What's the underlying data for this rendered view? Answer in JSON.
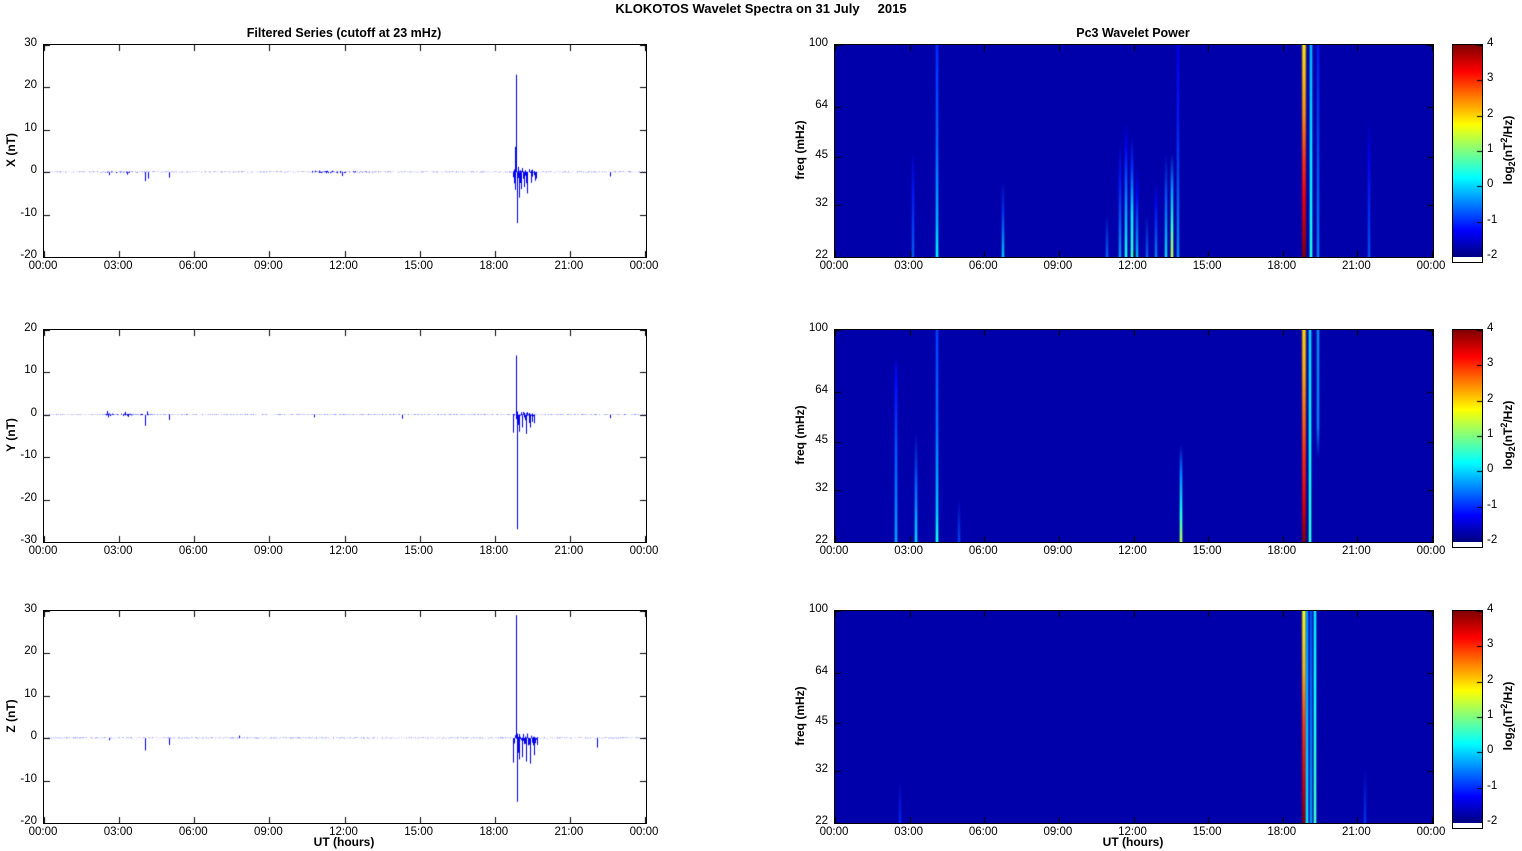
{
  "figure_title": "KLOKOTOS Wavelet Spectra on 31 July     2015",
  "left_column": {
    "title": "Filtered Series (cutoff at 23 mHz)",
    "xlabel": "UT (hours)"
  },
  "right_column": {
    "title": "Pc3 Wavelet Power",
    "xlabel": "UT (hours)",
    "colorbar": {
      "label_parts": {
        "pre": "log",
        "sub": "2",
        "mid": "(nT",
        "sup": "2",
        "post": "/Hz)"
      },
      "ticks": [
        4,
        3,
        2,
        1,
        0,
        -1,
        -2
      ],
      "range": [
        -2,
        4
      ]
    }
  },
  "time_axis": {
    "tick_hours": [
      0,
      3,
      6,
      9,
      12,
      15,
      18,
      21,
      24
    ],
    "tick_labels": [
      "00:00",
      "03:00",
      "06:00",
      "09:00",
      "12:00",
      "15:00",
      "18:00",
      "21:00",
      "00:00"
    ],
    "range_hours": [
      0,
      24
    ]
  },
  "freq_axis": {
    "label": "freq (mHz)",
    "ticks": [
      22,
      32,
      45,
      64,
      100
    ],
    "range": [
      22,
      100
    ],
    "scale": "log"
  },
  "line_color": "#0000ee",
  "background_level": -1.75,
  "chart_data": [
    {
      "id": "ts-x",
      "type": "line",
      "ylabel": "X (nT)",
      "ylim": [
        -20,
        30
      ],
      "yticks": [
        -20,
        -10,
        0,
        10,
        20,
        30
      ],
      "noise_amp": 0.13,
      "busy": [
        [
          2.4,
          4.3,
          0.4,
          0.3
        ],
        [
          10.6,
          13.2,
          0.5,
          0.45
        ],
        [
          18.72,
          19.7,
          5,
          1.6
        ]
      ],
      "spikes": [
        [
          2.6,
          -0.7
        ],
        [
          3.3,
          -0.6
        ],
        [
          4.05,
          -2.1
        ],
        [
          4.15,
          -1.5
        ],
        [
          5.0,
          -1.3
        ],
        [
          11.9,
          -0.9
        ],
        [
          18.82,
          6
        ],
        [
          18.86,
          23
        ],
        [
          18.88,
          -12
        ],
        [
          18.95,
          -6
        ],
        [
          19.05,
          -4
        ],
        [
          19.15,
          -3.5
        ],
        [
          19.3,
          -5
        ],
        [
          19.45,
          -2.5
        ],
        [
          19.6,
          -2
        ],
        [
          22.6,
          -1
        ]
      ]
    },
    {
      "id": "ts-y",
      "type": "line",
      "ylabel": "Y (nT)",
      "ylim": [
        -30,
        20
      ],
      "yticks": [
        -30,
        -20,
        -10,
        0,
        10,
        20
      ],
      "noise_amp": 0.13,
      "busy": [
        [
          2.4,
          4.4,
          0.55,
          0.5
        ],
        [
          18.72,
          19.6,
          4.5,
          1.2
        ]
      ],
      "spikes": [
        [
          2.5,
          0.9
        ],
        [
          2.55,
          -0.6
        ],
        [
          3.25,
          0.7
        ],
        [
          3.35,
          -0.5
        ],
        [
          4.05,
          -2.6
        ],
        [
          4.1,
          0.8
        ],
        [
          5.0,
          -1.2
        ],
        [
          10.8,
          -0.6
        ],
        [
          14.3,
          -0.9
        ],
        [
          18.84,
          14
        ],
        [
          18.87,
          -27
        ],
        [
          18.95,
          -4
        ],
        [
          19.1,
          -3
        ],
        [
          19.25,
          -4.5
        ],
        [
          19.4,
          -3
        ],
        [
          19.55,
          -2
        ],
        [
          22.6,
          -0.8
        ]
      ]
    },
    {
      "id": "ts-z",
      "type": "line",
      "ylabel": "Z (nT)",
      "ylim": [
        -20,
        30
      ],
      "yticks": [
        -20,
        -10,
        0,
        10,
        20,
        30
      ],
      "noise_amp": 0.13,
      "busy": [
        [
          18.72,
          19.7,
          6,
          1.8
        ]
      ],
      "spikes": [
        [
          2.6,
          -0.5
        ],
        [
          4.05,
          -2.9
        ],
        [
          5.0,
          -1.6
        ],
        [
          7.8,
          0.6
        ],
        [
          18.83,
          29
        ],
        [
          18.87,
          -15
        ],
        [
          18.95,
          -5
        ],
        [
          19.1,
          -4.5
        ],
        [
          19.25,
          -5.5
        ],
        [
          19.4,
          -6
        ],
        [
          19.55,
          -4
        ],
        [
          22.1,
          -2.2
        ]
      ]
    },
    {
      "id": "sp-x",
      "type": "heatmap",
      "series": "X",
      "flim": [
        22,
        100
      ],
      "clim": [
        -2,
        4
      ],
      "events": [
        {
          "t": 3.15,
          "stops": [
            [
              22,
              -0.6
            ],
            [
              35,
              -1.1
            ],
            [
              48,
              -1.75
            ]
          ]
        },
        {
          "t": 4.1,
          "w": 2,
          "stops": [
            [
              22,
              0.2
            ],
            [
              28,
              -0.2
            ],
            [
              50,
              -0.7
            ],
            [
              100,
              -1.0
            ]
          ]
        },
        {
          "t": 6.75,
          "stops": [
            [
              22,
              0.1
            ],
            [
              30,
              -0.9
            ],
            [
              38,
              -1.75
            ]
          ]
        },
        {
          "t": 10.95,
          "stops": [
            [
              22,
              -0.6
            ],
            [
              30,
              -1.75
            ]
          ]
        },
        {
          "t": 11.45,
          "stops": [
            [
              22,
              -0.2
            ],
            [
              38,
              -1.1
            ],
            [
              50,
              -1.75
            ]
          ]
        },
        {
          "t": 11.7,
          "w": 2,
          "stops": [
            [
              22,
              0.4
            ],
            [
              32,
              -0.4
            ],
            [
              48,
              -1.3
            ],
            [
              58,
              -1.75
            ]
          ]
        },
        {
          "t": 11.95,
          "w": 2,
          "stops": [
            [
              22,
              0.6
            ],
            [
              30,
              0.1
            ],
            [
              42,
              -1.0
            ],
            [
              52,
              -1.75
            ]
          ]
        },
        {
          "t": 12.15,
          "stops": [
            [
              22,
              0.0
            ],
            [
              34,
              -1.2
            ],
            [
              42,
              -1.75
            ]
          ]
        },
        {
          "t": 12.55,
          "stops": [
            [
              22,
              -0.6
            ],
            [
              30,
              -1.75
            ]
          ]
        },
        {
          "t": 12.9,
          "stops": [
            [
              22,
              -0.4
            ],
            [
              32,
              -1.2
            ],
            [
              38,
              -1.75
            ]
          ]
        },
        {
          "t": 13.3,
          "stops": [
            [
              22,
              0.3
            ],
            [
              34,
              -0.7
            ],
            [
              46,
              -1.75
            ]
          ]
        },
        {
          "t": 13.55,
          "w": 2,
          "stops": [
            [
              22,
              1.4
            ],
            [
              27,
              0.6
            ],
            [
              36,
              -0.4
            ],
            [
              46,
              -1.75
            ]
          ]
        },
        {
          "t": 13.8,
          "stops": [
            [
              22,
              -0.3
            ],
            [
              60,
              -1.1
            ],
            [
              100,
              -1.3
            ]
          ]
        },
        {
          "t": 18.85,
          "w": 3,
          "stops": [
            [
              22,
              4
            ],
            [
              26,
              3.7
            ],
            [
              34,
              3.3
            ],
            [
              45,
              2.9
            ],
            [
              60,
              2.4
            ],
            [
              80,
              2.1
            ],
            [
              100,
              1.9
            ]
          ]
        },
        {
          "t": 19.15,
          "w": 2,
          "stops": [
            [
              22,
              0.4
            ],
            [
              45,
              0.1
            ],
            [
              100,
              -0.2
            ]
          ]
        },
        {
          "t": 19.4,
          "stops": [
            [
              22,
              -0.4
            ],
            [
              100,
              -1.1
            ]
          ]
        },
        {
          "t": 21.45,
          "stops": [
            [
              22,
              -0.7
            ],
            [
              45,
              -1.3
            ],
            [
              60,
              -1.75
            ]
          ]
        }
      ]
    },
    {
      "id": "sp-y",
      "type": "heatmap",
      "series": "Y",
      "flim": [
        22,
        100
      ],
      "clim": [
        -2,
        4
      ],
      "events": [
        {
          "t": 2.45,
          "w": 2,
          "stops": [
            [
              22,
              -0.3
            ],
            [
              45,
              -0.8
            ],
            [
              70,
              -1.2
            ],
            [
              85,
              -1.75
            ]
          ]
        },
        {
          "t": 3.25,
          "w": 2,
          "stops": [
            [
              22,
              0.0
            ],
            [
              33,
              -0.7
            ],
            [
              48,
              -1.75
            ]
          ]
        },
        {
          "t": 4.1,
          "w": 2,
          "stops": [
            [
              22,
              0.4
            ],
            [
              28,
              -0.1
            ],
            [
              50,
              -0.6
            ],
            [
              100,
              -0.9
            ]
          ]
        },
        {
          "t": 5.0,
          "stops": [
            [
              22,
              -0.8
            ],
            [
              30,
              -1.75
            ]
          ]
        },
        {
          "t": 13.9,
          "w": 2,
          "stops": [
            [
              22,
              1.3
            ],
            [
              27,
              0.4
            ],
            [
              36,
              -0.5
            ],
            [
              44,
              -1.75
            ]
          ]
        },
        {
          "t": 18.85,
          "w": 3,
          "stops": [
            [
              22,
              4
            ],
            [
              28,
              3.5
            ],
            [
              40,
              3.0
            ],
            [
              55,
              2.6
            ],
            [
              75,
              2.2
            ],
            [
              100,
              2.0
            ]
          ]
        },
        {
          "t": 19.1,
          "w": 2,
          "stops": [
            [
              22,
              0.5
            ],
            [
              50,
              0.2
            ],
            [
              100,
              0.0
            ]
          ]
        },
        {
          "t": 19.4,
          "stops": [
            [
              22,
              -1.75
            ],
            [
              40,
              -1.75
            ],
            [
              50,
              -0.4
            ],
            [
              100,
              -0.3
            ]
          ]
        }
      ]
    },
    {
      "id": "sp-z",
      "type": "heatmap",
      "series": "Z",
      "flim": [
        22,
        100
      ],
      "clim": [
        -2,
        4
      ],
      "events": [
        {
          "t": 2.6,
          "stops": [
            [
              22,
              -1.0
            ],
            [
              30,
              -1.75
            ]
          ]
        },
        {
          "t": 18.85,
          "w": 3,
          "stops": [
            [
              22,
              4
            ],
            [
              28,
              3.6
            ],
            [
              45,
              2.9
            ],
            [
              65,
              2.2
            ],
            [
              100,
              1.7
            ]
          ]
        },
        {
          "t": 18.98,
          "w": 2,
          "stops": [
            [
              22,
              0.1
            ],
            [
              100,
              -0.4
            ]
          ]
        },
        {
          "t": 19.12,
          "stops": [
            [
              22,
              -0.2
            ],
            [
              100,
              -0.7
            ]
          ]
        },
        {
          "t": 19.3,
          "w": 2,
          "stops": [
            [
              22,
              0.6
            ],
            [
              60,
              0.3
            ],
            [
              100,
              0.1
            ]
          ]
        },
        {
          "t": 21.3,
          "stops": [
            [
              22,
              -0.9
            ],
            [
              33,
              -1.75
            ]
          ]
        }
      ]
    }
  ]
}
